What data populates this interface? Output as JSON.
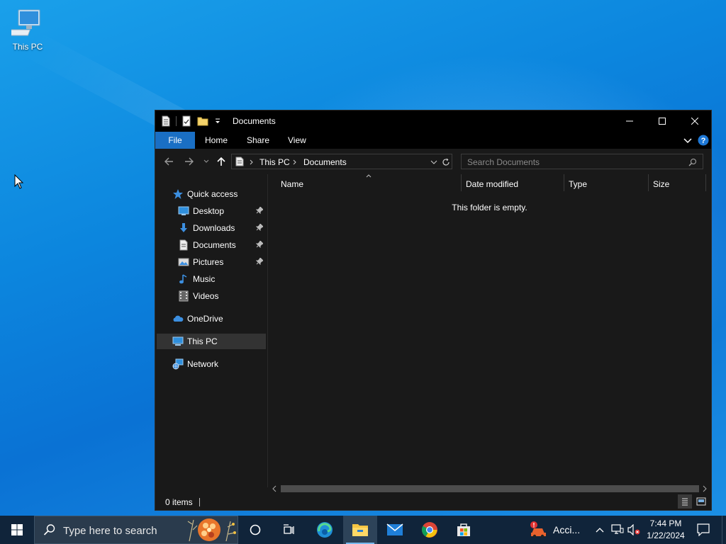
{
  "desktop": {
    "icons": [
      {
        "label": "This PC",
        "icon": "computer-icon"
      }
    ]
  },
  "window": {
    "title": "Documents",
    "ribbon_tabs": [
      "File",
      "Home",
      "Share",
      "View"
    ],
    "address": {
      "crumbs": [
        "This PC",
        "Documents"
      ]
    },
    "search": {
      "placeholder": "Search Documents"
    },
    "nav_pane": {
      "quick_access": "Quick access",
      "quick_items": [
        {
          "label": "Desktop",
          "icon": "desktop-folder-icon",
          "pinned": true
        },
        {
          "label": "Downloads",
          "icon": "downloads-icon",
          "pinned": true
        },
        {
          "label": "Documents",
          "icon": "documents-icon",
          "pinned": true
        },
        {
          "label": "Pictures",
          "icon": "pictures-icon",
          "pinned": true
        },
        {
          "label": "Music",
          "icon": "music-icon",
          "pinned": false
        },
        {
          "label": "Videos",
          "icon": "videos-icon",
          "pinned": false
        }
      ],
      "onedrive": "OneDrive",
      "this_pc": "This PC",
      "network": "Network"
    },
    "columns": [
      "Name",
      "Date modified",
      "Type",
      "Size"
    ],
    "empty_message": "This folder is empty.",
    "status": "0 items"
  },
  "taskbar": {
    "search_placeholder": "Type here to search",
    "apps": [
      "task-view-icon",
      "edge-icon",
      "file-explorer-icon",
      "mail-icon",
      "chrome-icon",
      "store-icon"
    ],
    "notification_label": "Acci...",
    "time": "7:44 PM",
    "date": "1/22/2024"
  },
  "colors": {
    "window_bg": "#191919",
    "titlebar_bg": "#000000",
    "file_tab": "#1a6fc4",
    "taskbar_bg": "#10243a",
    "help_blue": "#1e78d6"
  }
}
